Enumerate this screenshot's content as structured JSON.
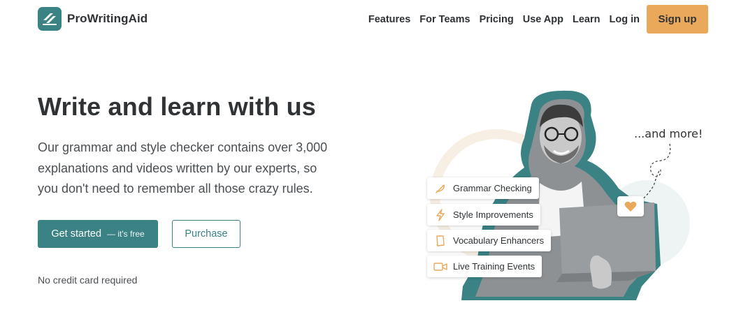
{
  "brand": {
    "name": "ProWritingAid"
  },
  "nav": {
    "features": "Features",
    "for_teams": "For Teams",
    "pricing": "Pricing",
    "use_app": "Use App",
    "learn": "Learn",
    "login": "Log in",
    "signup": "Sign up"
  },
  "hero": {
    "title": "Write and learn with us",
    "description": "Our grammar and style checker contains over 3,000 explanations and videos written by our experts, so you don't need to remember all those crazy rules.",
    "cta_primary": "Get started",
    "cta_primary_sub": "— it's free",
    "cta_secondary": "Purchase",
    "note": "No credit card required"
  },
  "illustration": {
    "more_text": "...and more!",
    "features": [
      {
        "label": "Grammar Checking",
        "icon": "feather-icon"
      },
      {
        "label": "Style Improvements",
        "icon": "lightning-icon"
      },
      {
        "label": "Vocabulary Enhancers",
        "icon": "book-icon"
      },
      {
        "label": "Live Training Events",
        "icon": "video-camera-icon"
      }
    ],
    "heart_icon": "heart-icon"
  },
  "colors": {
    "brand_teal": "#3a8284",
    "accent_orange": "#eaa85b",
    "text_dark": "#2f3336"
  }
}
